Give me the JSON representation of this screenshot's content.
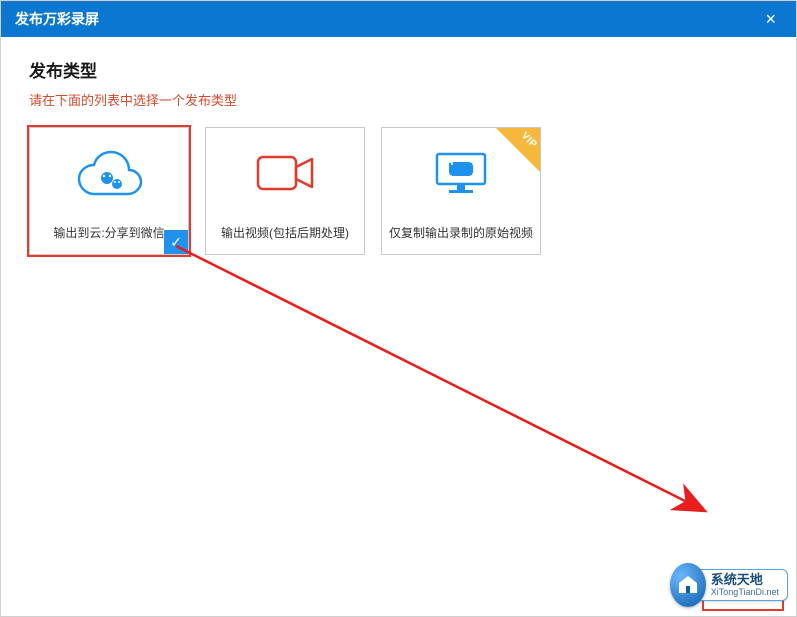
{
  "window": {
    "title": "发布万彩录屏",
    "close_glyph": "×"
  },
  "section": {
    "title": "发布类型",
    "hint": "请在下面的列表中选择一个发布类型"
  },
  "options": {
    "cloud": {
      "label": "输出到云:分享到微信",
      "selected": true
    },
    "video": {
      "label": "输出视频(包括后期处理)"
    },
    "copy": {
      "label": "仅复制输出录制的原始视频",
      "vip": true,
      "vip_text": "VIP"
    }
  },
  "check_glyph": "✓",
  "next_button": {
    "label": ""
  },
  "watermark": {
    "line1": "系统天地",
    "line2": "XiTongTianDi.net"
  }
}
